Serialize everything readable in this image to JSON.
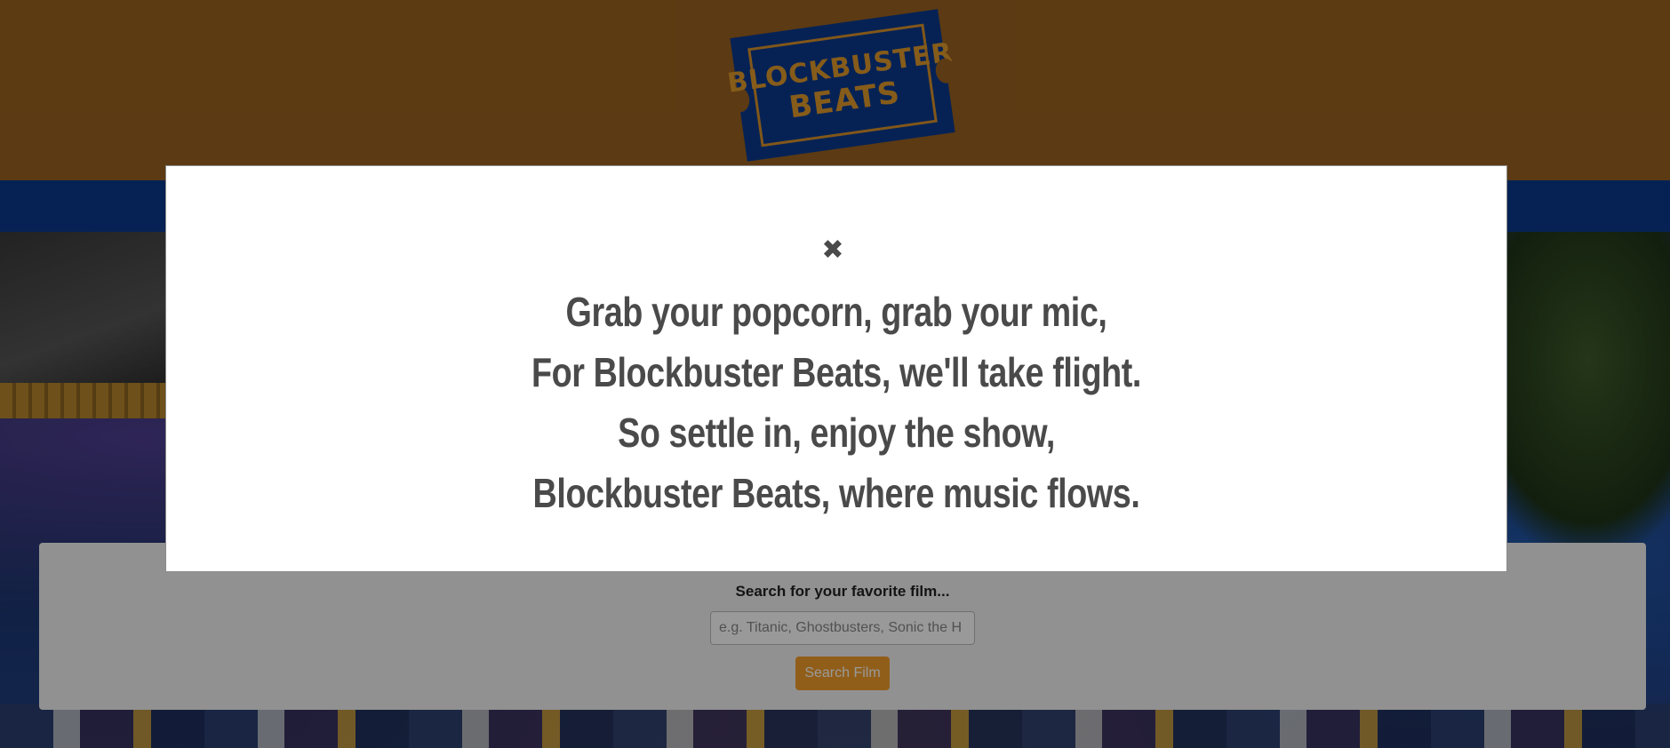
{
  "header": {
    "logo": {
      "line1": "BLOCKBUSTER",
      "line2": "BEATS",
      "colors": {
        "ticket": "#0a3a8e",
        "text": "#e09a2c"
      }
    },
    "background_color": "#9a6220"
  },
  "navbar": {
    "background_color": "#0a3a8e"
  },
  "search": {
    "label": "Search for your favorite film...",
    "placeholder": "e.g. Titanic, Ghostbusters, Sonic the H",
    "value": "",
    "button_label": "Search Film",
    "button_color": "#f29d2c"
  },
  "modal": {
    "close_icon": "✖",
    "poem": [
      "Grab your popcorn, grab your mic,",
      "For Blockbuster Beats, we'll take flight.",
      "So settle in, enjoy the show,",
      "Blockbuster Beats, where music flows."
    ],
    "text_color": "#4a4a4a"
  }
}
